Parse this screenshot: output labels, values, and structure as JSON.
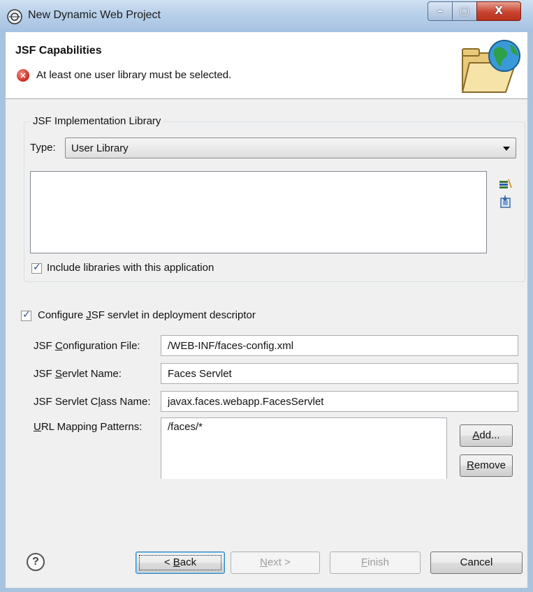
{
  "window": {
    "title": "New Dynamic Web Project",
    "minimize_glyph": "–",
    "maximize_glyph": "▢",
    "close_glyph": "X"
  },
  "header": {
    "title": "JSF Capabilities",
    "error_message": "At least one user library must be selected.",
    "error_icon_glyph": "×"
  },
  "impl_library": {
    "group_title": "JSF Implementation Library",
    "type_label": "Type:",
    "type_value": "User Library",
    "libraries": [],
    "include_libraries": {
      "label": "Include libraries with this application",
      "checked": true
    }
  },
  "servlet": {
    "configure": {
      "label_prefix": "Configure ",
      "label_mnemonic": "J",
      "label_suffix": "SF servlet in deployment descriptor",
      "checked": true
    },
    "config_file": {
      "label_prefix": "JSF ",
      "label_mnemonic": "C",
      "label_suffix": "onfiguration File:",
      "value": "/WEB-INF/faces-config.xml"
    },
    "servlet_name": {
      "label_prefix": "JSF ",
      "label_mnemonic": "S",
      "label_suffix": "ervlet Name:",
      "value": "Faces Servlet"
    },
    "servlet_class": {
      "label_prefix": "JSF Servlet C",
      "label_mnemonic": "l",
      "label_suffix": "ass Name:",
      "value": "javax.faces.webapp.FacesServlet"
    },
    "url_mapping": {
      "label_mnemonic": "U",
      "label_suffix": "RL Mapping Patterns:",
      "items": [
        "/faces/*"
      ]
    },
    "add_button": {
      "mnemonic": "A",
      "rest": "dd..."
    },
    "remove_button": {
      "mnemonic": "R",
      "rest": "emove"
    }
  },
  "footer": {
    "help_glyph": "?",
    "back": {
      "prefix": "< ",
      "mnemonic": "B",
      "rest": "ack"
    },
    "next": {
      "mnemonic": "N",
      "rest": "ext >"
    },
    "finish": {
      "mnemonic": "F",
      "rest": "inish"
    },
    "cancel": "Cancel"
  }
}
